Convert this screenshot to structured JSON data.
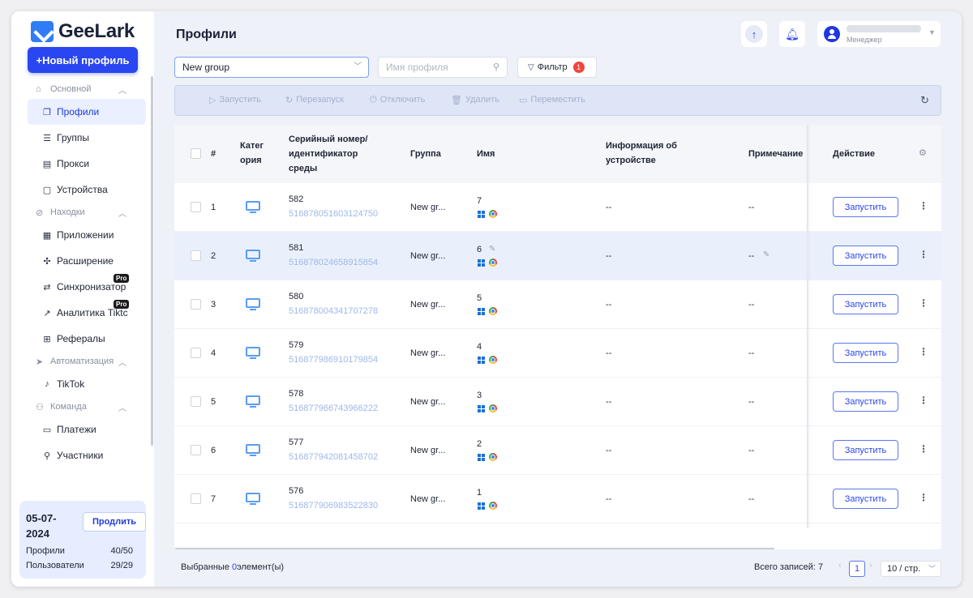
{
  "app": {
    "name": "GeeLark"
  },
  "sidebar": {
    "new_profile": "+Новый профиль",
    "sections": [
      {
        "label": "Основной",
        "items": [
          "Профили",
          "Группы",
          "Прокси",
          "Устройства"
        ]
      },
      {
        "label": "Находки",
        "items": [
          "Приложении",
          "Расширение",
          "Синхронизатор",
          "Аналитика Tiktc",
          "Рефералы"
        ]
      },
      {
        "label": "Автоматизация",
        "items": [
          "TikTok"
        ]
      },
      {
        "label": "Команда",
        "items": [
          "Платежи",
          "Участники"
        ]
      }
    ],
    "pro_label": "Pro",
    "subscription": {
      "date": "05-07-2024",
      "renew": "Продлить",
      "profiles_label": "Профили",
      "profiles_value": "40/50",
      "users_label": "Пользователи",
      "users_value": "29/29"
    }
  },
  "header": {
    "title": "Профили",
    "user_role": "Менеджер"
  },
  "toolbar": {
    "group_value": "New group",
    "search_placeholder": "Имя профиля",
    "filter_label": "Фильтр",
    "filter_count": "1",
    "actions": [
      "Запустить",
      "Перезапуск",
      "Отключить",
      "Удалить",
      "Переместить"
    ]
  },
  "table": {
    "headers": {
      "num": "#",
      "category": "Катег\nория",
      "serial": "Серийный номер/\nидентификатор\nсреды",
      "group": "Группа",
      "name": "Имя",
      "device": "Информация об\nустройстве",
      "note": "Примечание",
      "action": "Действие"
    },
    "launch_label": "Запустить",
    "rows": [
      {
        "n": "1",
        "serial": "582",
        "env": "516878051603124750",
        "group": "New gr...",
        "name": "7",
        "device": "--",
        "note": "--"
      },
      {
        "n": "2",
        "serial": "581",
        "env": "516878024658915854",
        "group": "New gr...",
        "name": "6",
        "device": "--",
        "note": "--"
      },
      {
        "n": "3",
        "serial": "580",
        "env": "516878004341707278",
        "group": "New gr...",
        "name": "5",
        "device": "--",
        "note": "--"
      },
      {
        "n": "4",
        "serial": "579",
        "env": "516877986910179854",
        "group": "New gr...",
        "name": "4",
        "device": "--",
        "note": "--"
      },
      {
        "n": "5",
        "serial": "578",
        "env": "516877966743966222",
        "group": "New gr...",
        "name": "3",
        "device": "--",
        "note": "--"
      },
      {
        "n": "6",
        "serial": "577",
        "env": "516877942081458702",
        "group": "New gr...",
        "name": "2",
        "device": "--",
        "note": "--"
      },
      {
        "n": "7",
        "serial": "576",
        "env": "516877906983522830",
        "group": "New gr...",
        "name": "1",
        "device": "--",
        "note": "--"
      }
    ]
  },
  "footer": {
    "selected_prefix": "Выбранные",
    "selected_count": "0",
    "selected_suffix": "элемент(ы)",
    "total": "Всего записей: 7",
    "page": "1",
    "page_size": "10 / стр."
  }
}
